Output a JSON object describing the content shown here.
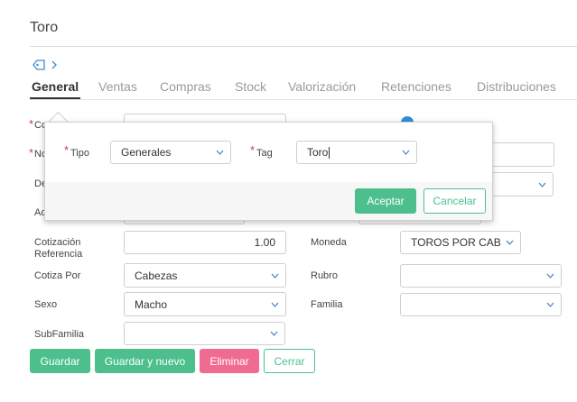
{
  "header": {
    "title": "Toro"
  },
  "tabs": [
    {
      "label": "General",
      "active": true
    },
    {
      "label": "Ventas"
    },
    {
      "label": "Compras"
    },
    {
      "label": "Stock"
    },
    {
      "label": "Valorización"
    },
    {
      "label": "Retenciones"
    },
    {
      "label": "Distribuciones"
    }
  ],
  "form": {
    "required_mark": "*",
    "label_co": "Co",
    "label_no": "No",
    "label_de": "De",
    "label_ac": "Ac",
    "cotizacion_label_1": "Cotización",
    "cotizacion_label_2": "Referencia",
    "cotizacion_value": "1.00",
    "moneda_label": "Moneda",
    "moneda_value": "TOROS POR CAB",
    "cotiza_por_label": "Cotiza Por",
    "cotiza_por_value": "Cabezas",
    "rubro_label": "Rubro",
    "rubro_value": "",
    "sexo_label": "Sexo",
    "sexo_value": "Macho",
    "familia_label": "Familia",
    "familia_value": "",
    "subfamilia_label": "SubFamilia",
    "subfamilia_value": ""
  },
  "actions": {
    "guardar": "Guardar",
    "guardar_nuevo": "Guardar y nuevo",
    "eliminar": "Eliminar",
    "cerrar": "Cerrar"
  },
  "popup": {
    "tipo_label": "Tipo",
    "tipo_value": "Generales",
    "tag_label": "Tag",
    "tag_value": "Toro",
    "aceptar": "Aceptar",
    "cancelar": "Cancelar"
  },
  "colors": {
    "accent": "#4cbf8d",
    "danger": "#f06b92",
    "required": "#e03040",
    "info_dot": "#2a8fd6"
  }
}
